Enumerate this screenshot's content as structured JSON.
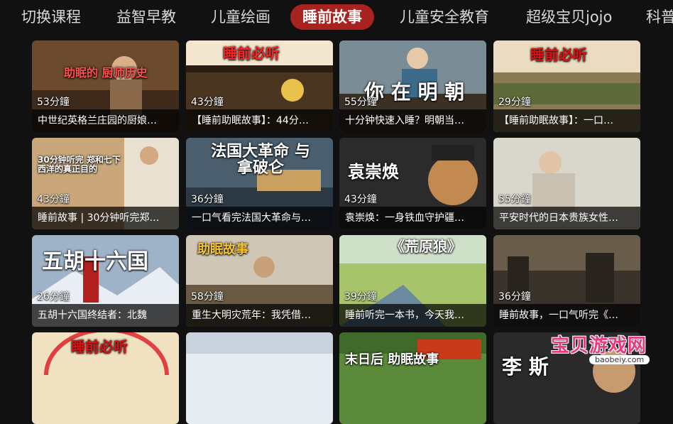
{
  "tabs": [
    {
      "label": "切换课程"
    },
    {
      "label": "益智早教"
    },
    {
      "label": "儿童绘画"
    },
    {
      "label": "睡前故事"
    },
    {
      "label": "儿童安全教育"
    },
    {
      "label": "超级宝贝jojo"
    },
    {
      "label": "科普"
    }
  ],
  "active_tab_color": "#a8231f",
  "cards": [
    {
      "duration": "53分鐘",
      "caption": "中世纪英格兰庄园的厨娘…",
      "overlay": "助眠的 厨师历史",
      "overlay_color": "#ff5050"
    },
    {
      "duration": "43分鐘",
      "caption": "【睡前助眠故事】：44分…",
      "overlay": "睡前必听",
      "overlay_color": "#ff2222"
    },
    {
      "duration": "55分鐘",
      "caption": "十分钟快速入睡？明朝当…",
      "overlay": "你 在 明 朝",
      "overlay_color": "#ffffff"
    },
    {
      "duration": "29分鐘",
      "caption": "【睡前助眠故事】：一口…",
      "overlay": "睡前必听",
      "overlay_color": "#e01010"
    },
    {
      "duration": "43分鐘",
      "caption": "睡前故事 | 30分钟听完郑…",
      "overlay": "30分钟听完 郑和七下西洋的真正目的",
      "overlay_color": "#ffffff"
    },
    {
      "duration": "36分鐘",
      "caption": "一口气看完法国大革命与…",
      "overlay": "法国大革命 与 拿破仑",
      "overlay_color": "#ffffff"
    },
    {
      "duration": "43分鐘",
      "caption": "袁崇焕：一身铁血守护疆…",
      "overlay": "袁崇焕",
      "overlay_color": "#ffffff"
    },
    {
      "duration": "55分鐘",
      "caption": "平安时代的日本贵族女性…",
      "overlay": "",
      "overlay_color": "#ffffff"
    },
    {
      "duration": "26分鐘",
      "caption": "五胡十六国终结者：北魏",
      "overlay": "五胡十六国",
      "overlay_color": "#ffffff"
    },
    {
      "duration": "58分鐘",
      "caption": "重生大明灾荒年：我凭借…",
      "overlay": "助眠故事",
      "overlay_color": "#f4c430"
    },
    {
      "duration": "39分鐘",
      "caption": "睡前听完一本书，今天我…",
      "overlay": "《荒原狼》",
      "overlay_color": "#ffffff"
    },
    {
      "duration": "36分鐘",
      "caption": "睡前故事，一口气听完《…",
      "overlay": "",
      "overlay_color": "#ffffff"
    },
    {
      "duration": "",
      "caption": "",
      "overlay": "睡前必听",
      "overlay_color": "#e01010"
    },
    {
      "duration": "",
      "caption": "",
      "overlay": "",
      "overlay_color": "#ffffff"
    },
    {
      "duration": "",
      "caption": "",
      "overlay": "末日后 助眠故事",
      "overlay_color": "#ffffff"
    },
    {
      "duration": "",
      "caption": "",
      "overlay": "李 斯",
      "overlay_color": "#ffffff"
    }
  ],
  "watermark": {
    "text": "宝贝游戏网",
    "url": "baobeiy.com"
  }
}
